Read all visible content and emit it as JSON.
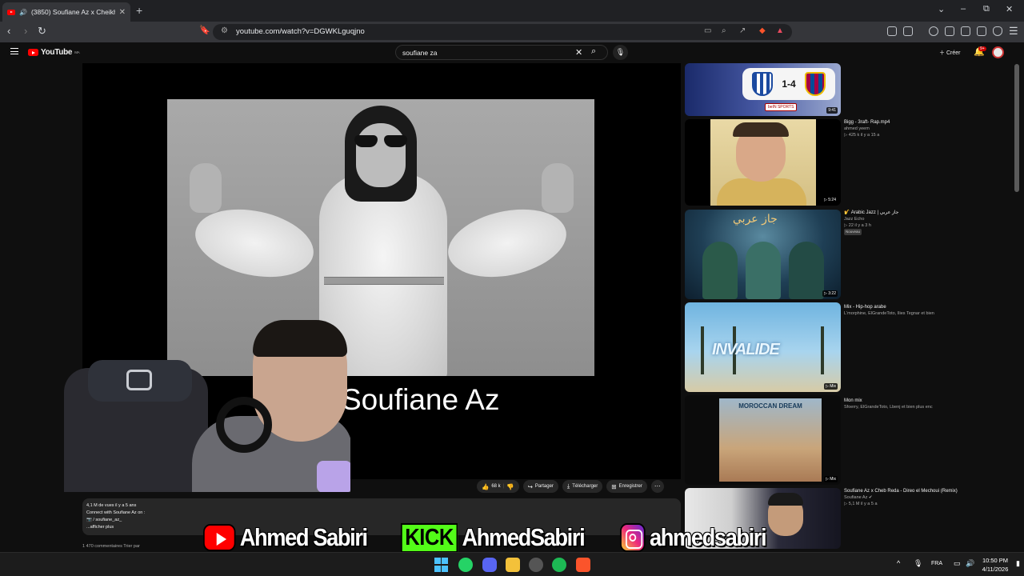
{
  "browser": {
    "tab_title": "(3850) Soufiane Az x Cheikha",
    "new_tab": "+",
    "url": "youtube.com/watch?v=DGWKLguqjno",
    "window_controls": [
      "⌄",
      "–",
      "⧉",
      "✕"
    ]
  },
  "youtube": {
    "logo_text": "YouTube",
    "logo_region": "MA",
    "search_query": "soufiane za",
    "create_label": "Créer",
    "notification_count": "9+"
  },
  "player": {
    "video_overlay_title": "Soufiane Az"
  },
  "actions": {
    "likes": "68 k",
    "share": "Partager",
    "download": "Télécharger",
    "save": "Enregistrer"
  },
  "description": {
    "stats": "4,1 M de vues  il y a 5 ans",
    "line1": "Connect with Soufiane Az on :",
    "handle": "📷 / soufiane_az_",
    "more": "...afficher plus",
    "comments_peek": "1 470 commentaires     Trier par"
  },
  "recommendations": [
    {
      "title": "",
      "channel": "",
      "meta": "",
      "duration": "9:41"
    },
    {
      "title": "Bigg - 3raft- Rap.mp4",
      "channel": "ahmed yeem",
      "meta": "▷ 425 k  il y a 15 a",
      "duration": "▷ 5:24"
    },
    {
      "title": "🎷 Arabic Jazz | جاز عربي",
      "channel": "Jazz Echo",
      "meta": "▷ 22  il y a 3 h",
      "badge": "Nouveau",
      "duration": "▷ 3:22",
      "thumb_text": "جاز عربي"
    },
    {
      "title": "Mix - Hip-hop arabe",
      "channel": "L'morphine, ElGrandeToto, Ilies Tegnar et bien",
      "meta": "",
      "duration": "▷ Mix",
      "thumb_text": "INVALIDE"
    },
    {
      "title": "Mon mix",
      "channel": "Sfoerry, ElGrandeToto, Lbenj et bien plus enc",
      "meta": "",
      "duration": "▷ Mix",
      "thumb_text": "MOROCCAN DREAM"
    },
    {
      "title": "Soufiane Az x Cheb Reda - Direo el Mechoui (Remix)",
      "channel": "Soufiane Az ✔",
      "meta": "▷ 5,1 M  il y a 5 a",
      "duration": ""
    }
  ],
  "thumbnail_1": {
    "score": "1-4",
    "sponsor": "beIN SPORTS"
  },
  "overlay": {
    "youtube_handle": "Ahmed Sabiri",
    "kick_label": "KICK",
    "kick_handle": "AhmedSabiri",
    "instagram_handle": "ahmedsabiri"
  },
  "taskbar": {
    "language": "FRA",
    "time": "10:50 PM",
    "date": "4/11/2026"
  },
  "colors": {
    "youtube_red": "#ff0000",
    "kick_green": "#53fc18",
    "dark_bg": "#0f0f0f"
  }
}
